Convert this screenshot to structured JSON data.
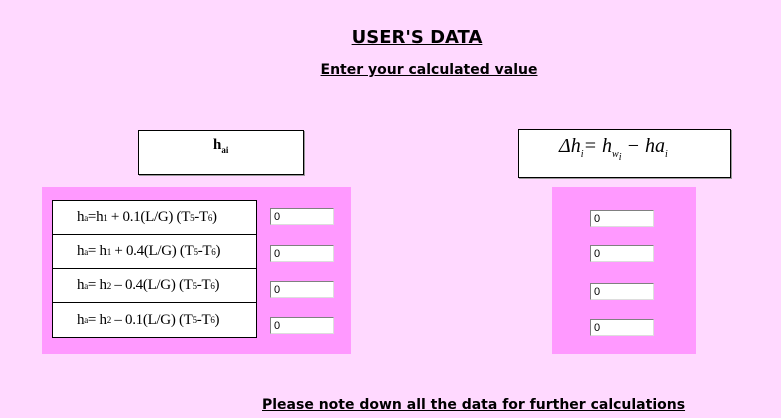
{
  "header": {
    "title": "USER'S DATA",
    "subtitle": "Enter your calculated value"
  },
  "left_header_label": "hai",
  "right_header_formula": "Δhi = hwi − hai",
  "formulas": [
    "ha=h1 + 0.1(L/G) (T5-T6)",
    "ha= h1 + 0.4(L/G) (T5-T6)",
    "ha= h2 – 0.4(L/G) (T5-T6)",
    "ha= h2 – 0.1(L/G) (T5-T6)"
  ],
  "ha_values": [
    "0",
    "0",
    "0",
    "0"
  ],
  "delta_h_values": [
    "0",
    "0",
    "0",
    "0"
  ],
  "footer": "Please note down all the data for further calculations",
  "colors": {
    "background": "#ffd9ff",
    "panel": "#ff99ff"
  }
}
